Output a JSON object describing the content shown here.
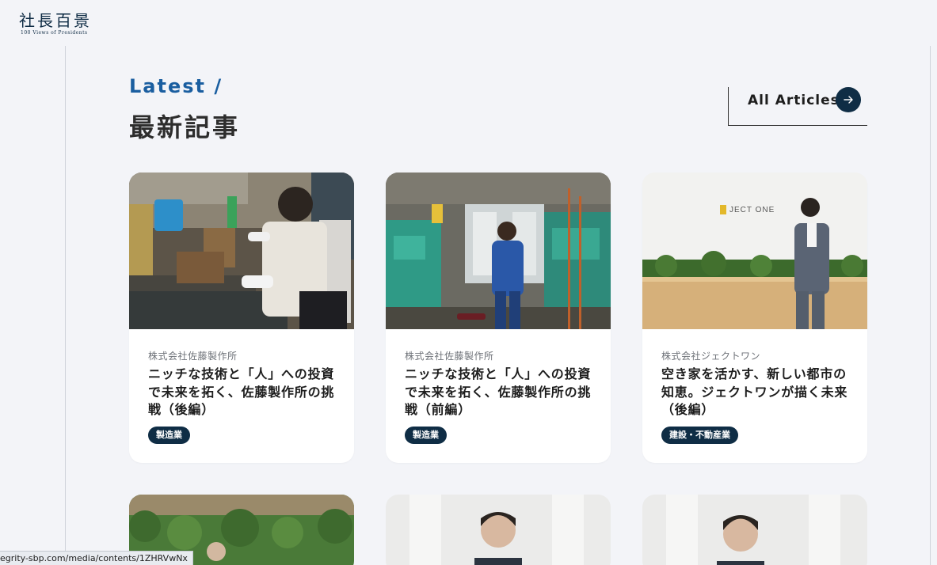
{
  "header": {
    "logo_main": "社長百景",
    "logo_sub": "100 Views of Presidents"
  },
  "section": {
    "title_en": "Latest /",
    "title_ja": "最新記事",
    "all_articles_label": "All Articles"
  },
  "articles": [
    {
      "company": "株式会社佐藤製作所",
      "title": "ニッチな技術と「人」への投資で未来を拓く、佐藤製作所の挑戦（後編）",
      "tag": "製造業"
    },
    {
      "company": "株式会社佐藤製作所",
      "title": "ニッチな技術と「人」への投資で未来を拓く、佐藤製作所の挑戦（前編）",
      "tag": "製造業"
    },
    {
      "company": "株式会社ジェクトワン",
      "title": "空き家を活かす、新しい都市の知恵。ジェクトワンが描く未来（後編）",
      "tag": "建設・不動産業"
    }
  ],
  "image_text": {
    "signage": "JECT ONE"
  },
  "status_bar": {
    "url": "egrity-sbp.com/media/contents/1ZHRVwNx"
  },
  "colors": {
    "background": "#f3f4f8",
    "accent_blue": "#1a5ea0",
    "navy": "#0f2d45",
    "card": "#ffffff"
  },
  "icons": [
    "arrow-right-icon"
  ]
}
